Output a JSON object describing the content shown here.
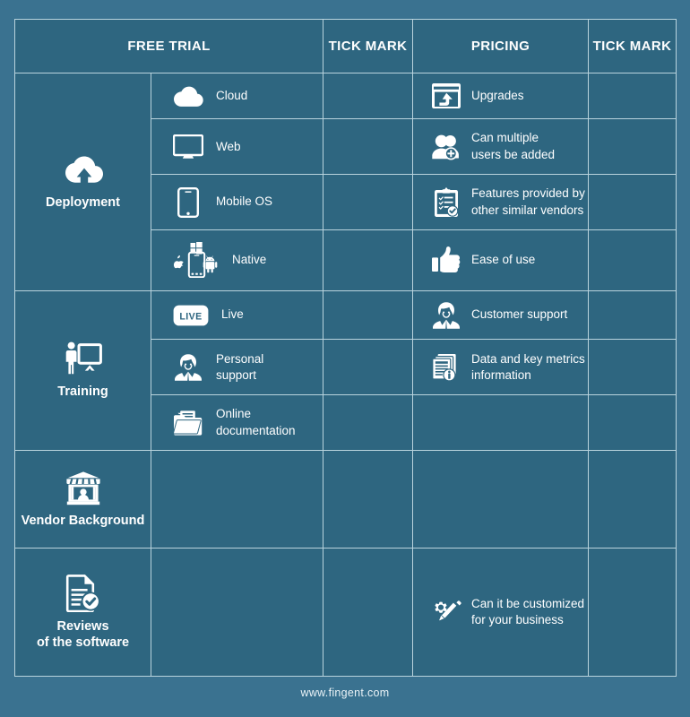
{
  "header": {
    "free_trial": "FREE TRIAL",
    "tick_mark_1": "TICK MARK",
    "pricing": "PRICING",
    "tick_mark_2": "TICK MARK"
  },
  "colors": {
    "page_background": "#3a7290",
    "cell": "#2e6680",
    "tick_column": "#3d92a8",
    "border": "#b9d3dd",
    "text": "#ffffff"
  },
  "categories": [
    {
      "label": "Deployment",
      "icon": "cloud-upload-icon"
    },
    {
      "label": "Training",
      "icon": "presentation-trainer-icon"
    },
    {
      "label": "Vendor Background",
      "icon": "storefront-icon"
    },
    {
      "label": "Reviews\nof the software",
      "icon": "document-check-icon"
    }
  ],
  "rows": [
    {
      "free_trial": "Cloud",
      "free_icon": "cloud-icon",
      "pricing": "Upgrades",
      "price_icon": "browser-upgrade-icon",
      "tick_1": "",
      "tick_2": ""
    },
    {
      "free_trial": "Web",
      "free_icon": "monitor-icon",
      "pricing": "Can multiple\nusers be added",
      "price_icon": "add-user-icon",
      "tick_1": "",
      "tick_2": ""
    },
    {
      "free_trial": "Mobile OS",
      "free_icon": "smartphone-icon",
      "pricing": "Features provided by\nother similar vendors",
      "price_icon": "clipboard-check-icon",
      "tick_1": "",
      "tick_2": ""
    },
    {
      "free_trial": "Native",
      "free_icon": "native-platforms-icon",
      "pricing": "Ease of use",
      "price_icon": "thumbs-up-icon",
      "tick_1": "",
      "tick_2": ""
    },
    {
      "free_trial": "Live",
      "free_icon": "live-badge-icon",
      "pricing": "Customer support",
      "price_icon": "support-agent-icon",
      "tick_1": "",
      "tick_2": ""
    },
    {
      "free_trial": "Personal\nsupport",
      "free_icon": "support-agent-icon",
      "pricing": "Data and key metrics\ninformation",
      "price_icon": "documents-info-icon",
      "tick_1": "",
      "tick_2": ""
    },
    {
      "free_trial": "Online\ndocumentation",
      "free_icon": "folder-docs-icon",
      "pricing": "",
      "price_icon": "",
      "tick_1": "",
      "tick_2": ""
    },
    {
      "free_trial": "",
      "free_icon": "",
      "pricing": "",
      "price_icon": "",
      "tick_1": "",
      "tick_2": ""
    },
    {
      "free_trial": "",
      "free_icon": "",
      "pricing": "Can it be customized\nfor your business",
      "price_icon": "gear-pencil-icon",
      "tick_1": "",
      "tick_2": ""
    }
  ],
  "footer": {
    "url": "www.fingent.com"
  }
}
